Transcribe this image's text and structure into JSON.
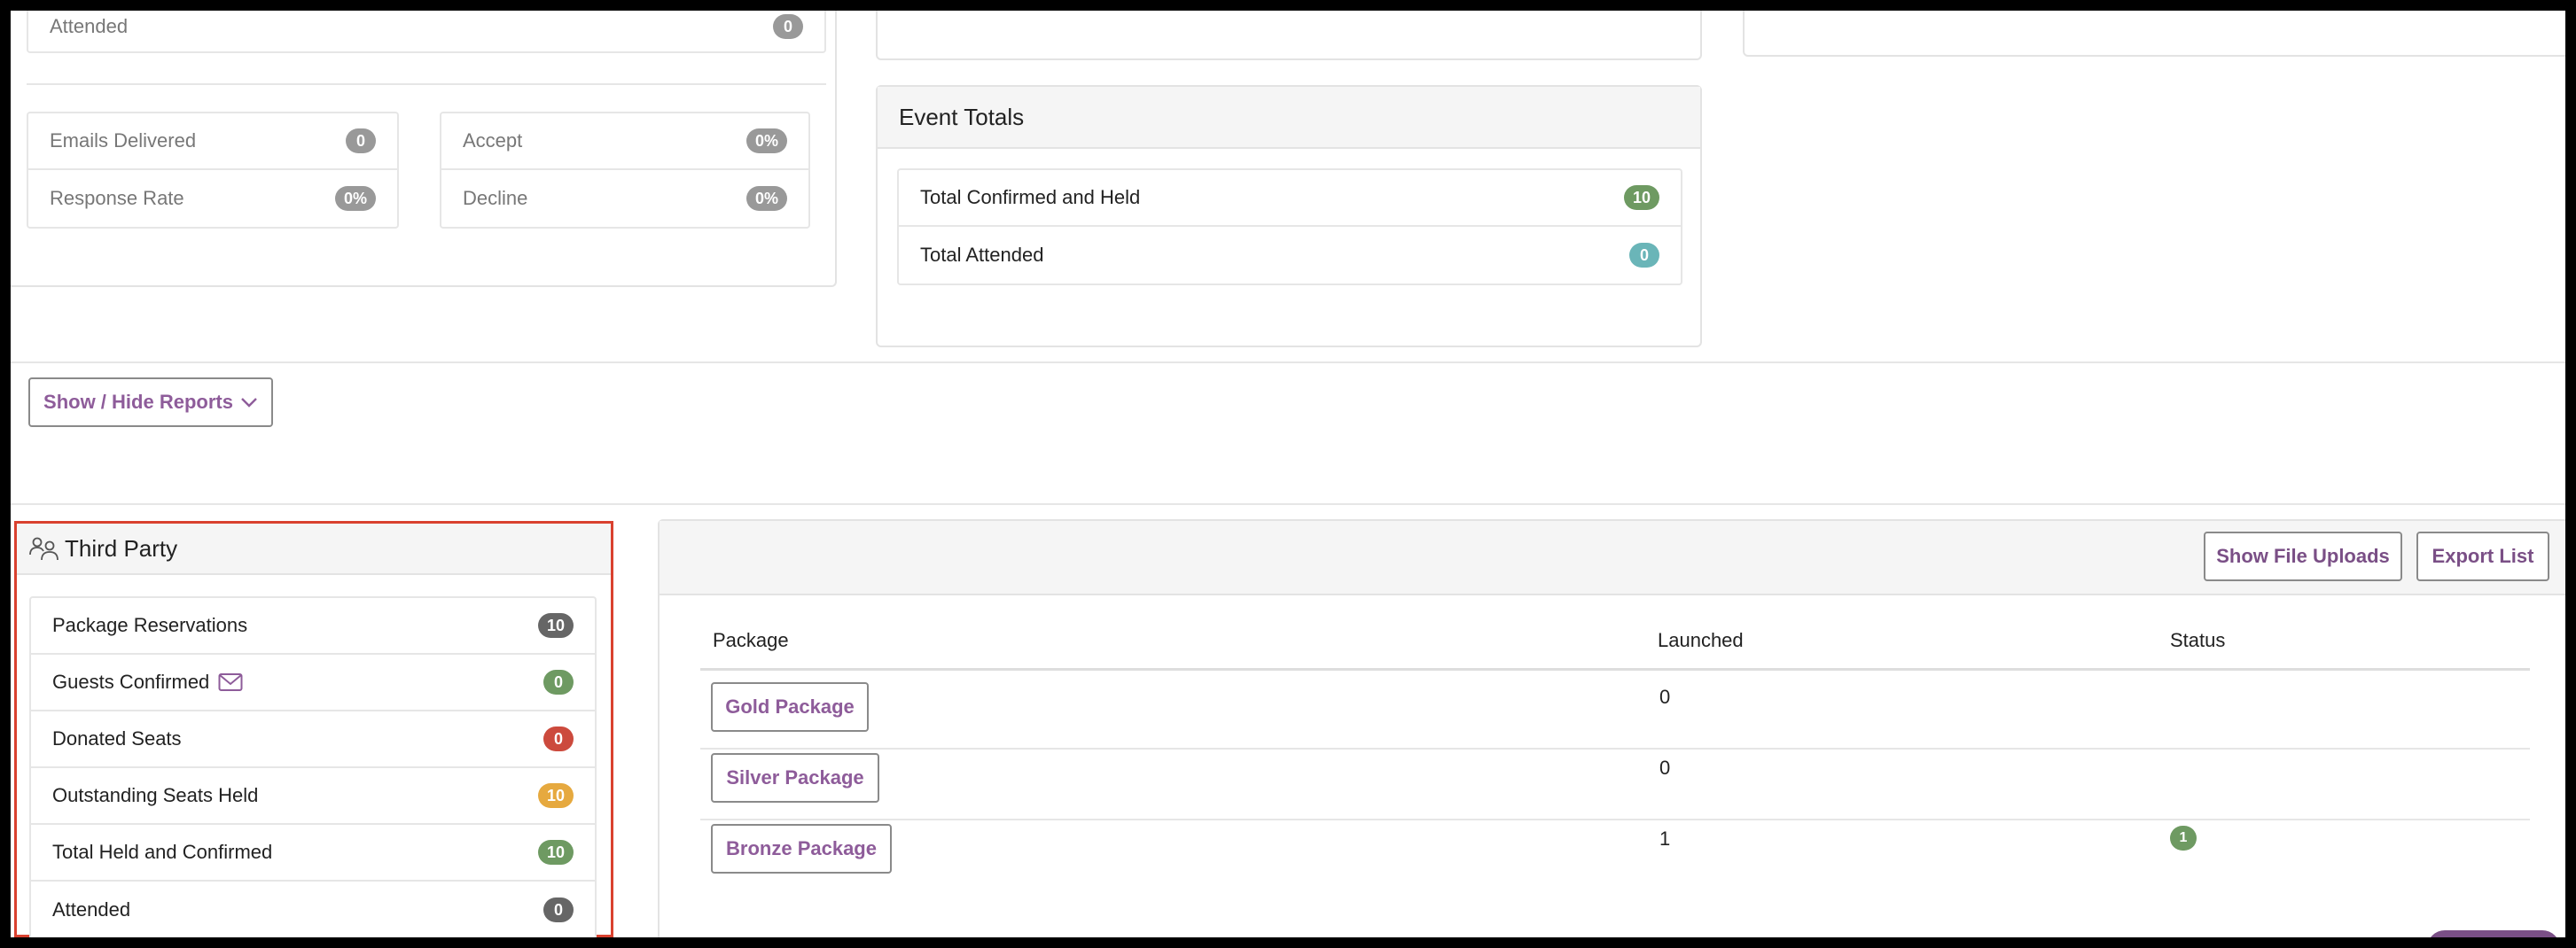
{
  "top_left_card": {
    "attended": {
      "label": "Attended",
      "value": "0"
    },
    "emails_delivered": {
      "label": "Emails Delivered",
      "value": "0"
    },
    "response_rate": {
      "label": "Response Rate",
      "value": "0%"
    },
    "accept": {
      "label": "Accept",
      "value": "0%"
    },
    "decline": {
      "label": "Decline",
      "value": "0%"
    }
  },
  "event_totals": {
    "title": "Event Totals",
    "rows": [
      {
        "label": "Total Confirmed and Held",
        "value": "10",
        "color": "#6e9a62"
      },
      {
        "label": "Total Attended",
        "value": "0",
        "color": "#6ab5b8"
      }
    ]
  },
  "show_hide_reports": {
    "label": "Show / Hide Reports",
    "icon": "chevron-down-icon"
  },
  "third_party": {
    "title": "Third Party",
    "icon": "users-icon",
    "rows": [
      {
        "label": "Package Reservations",
        "value": "10",
        "color": "#666666"
      },
      {
        "label": "Guests Confirmed",
        "value": "0",
        "color": "#6e9a62",
        "icon": "envelope-icon"
      },
      {
        "label": "Donated Seats",
        "value": "0",
        "color": "#cc4a3d"
      },
      {
        "label": "Outstanding Seats Held",
        "value": "10",
        "color": "#e6a93f"
      },
      {
        "label": "Total Held and Confirmed",
        "value": "10",
        "color": "#6e9a62"
      },
      {
        "label": "Attended",
        "value": "0",
        "color": "#666666"
      }
    ]
  },
  "packages": {
    "show_file_uploads": "Show File Uploads",
    "export_list": "Export List",
    "columns": [
      "Package",
      "Launched",
      "Status"
    ],
    "rows": [
      {
        "package": "Gold Package",
        "launched": "0",
        "status": ""
      },
      {
        "package": "Silver Package",
        "launched": "0",
        "status": ""
      },
      {
        "package": "Bronze Package",
        "launched": "1",
        "status": "1"
      }
    ]
  },
  "colors": {
    "accent": "#8e5c9a",
    "highlight_border": "#d9412f"
  }
}
